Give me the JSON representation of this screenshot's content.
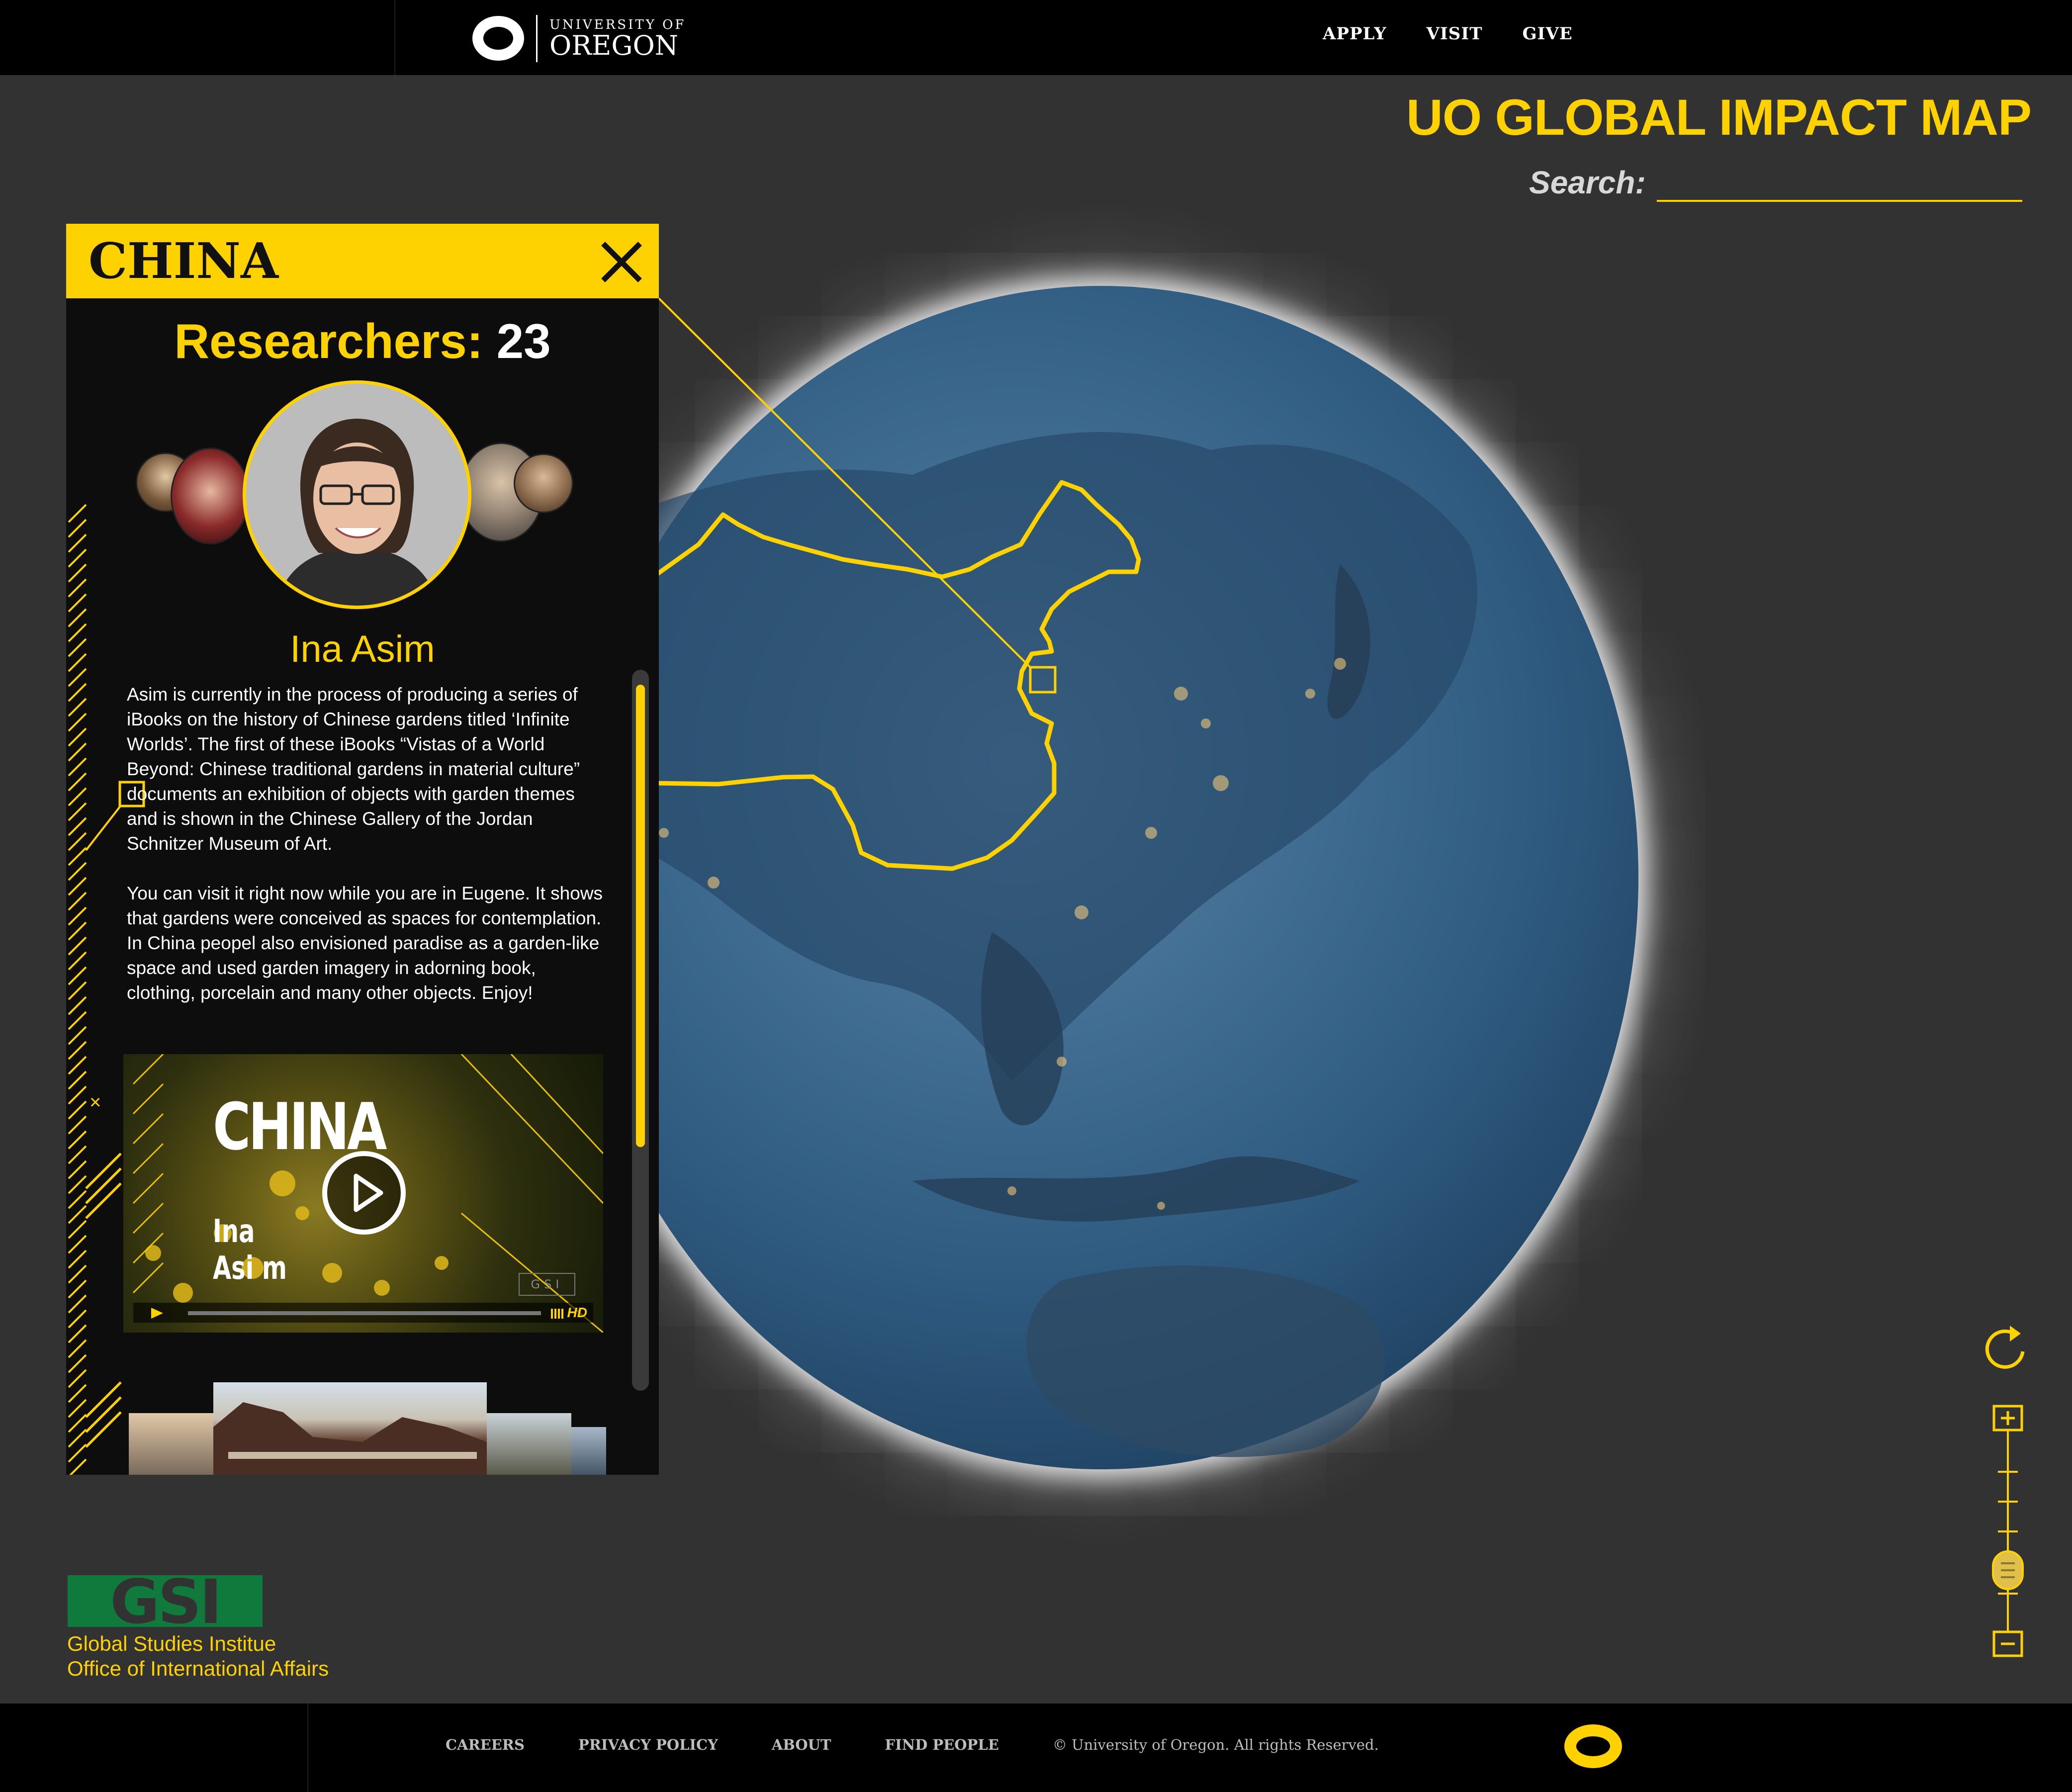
{
  "header": {
    "logo_small": "UNIVERSITY OF",
    "logo_big": "OREGON",
    "nav": [
      "APPLY",
      "VISIT",
      "GIVE"
    ]
  },
  "map": {
    "title": "UO GLOBAL IMPACT MAP",
    "search_label": "Search:",
    "search_value": ""
  },
  "panel": {
    "country": "CHINA",
    "researchers_label": "Researchers:",
    "researchers_count": "23",
    "researcher_name": "Ina Asim",
    "bio_paragraphs": [
      "Asim is currently in the process of producing a series of iBooks on the history of Chinese gardens titled ‘Infinite Worlds’. The first of these iBooks “Vistas of a World Beyond: Chinese traditional gardens in material culture” documents an exhibition of objects with garden themes and is shown in the Chinese Gallery of the Jordan Schnitzer Museum of Art.",
      "You can visit it right now while you are in Eugene. It shows that gardens were conceived as spaces for contemplation. In China peopel also envisioned paradise as a garden-like space and used garden imagery in adorning book, clothing, porcelain and many other objects. Enjoy!"
    ],
    "video": {
      "title": "CHINA",
      "name_line1": "Ina",
      "name_line2": "Asi m",
      "hd": "HD",
      "mark": "GSI"
    }
  },
  "branding": {
    "gsi_letters": "GSI",
    "line1": "Global Studies Institue",
    "line2": "Office of International Affairs"
  },
  "footer": {
    "links": [
      "CAREERS",
      "PRIVACY POLICY",
      "ABOUT",
      "FIND PEOPLE"
    ],
    "copyright": "© University of Oregon. All rights Reserved."
  },
  "colors": {
    "accent": "#fed100",
    "background": "#323232",
    "bar": "#000000",
    "gsi_green": "#0f7a3c"
  },
  "icons": [
    "close-icon",
    "play-icon",
    "refresh-icon",
    "zoom-in-icon",
    "zoom-out-icon"
  ]
}
